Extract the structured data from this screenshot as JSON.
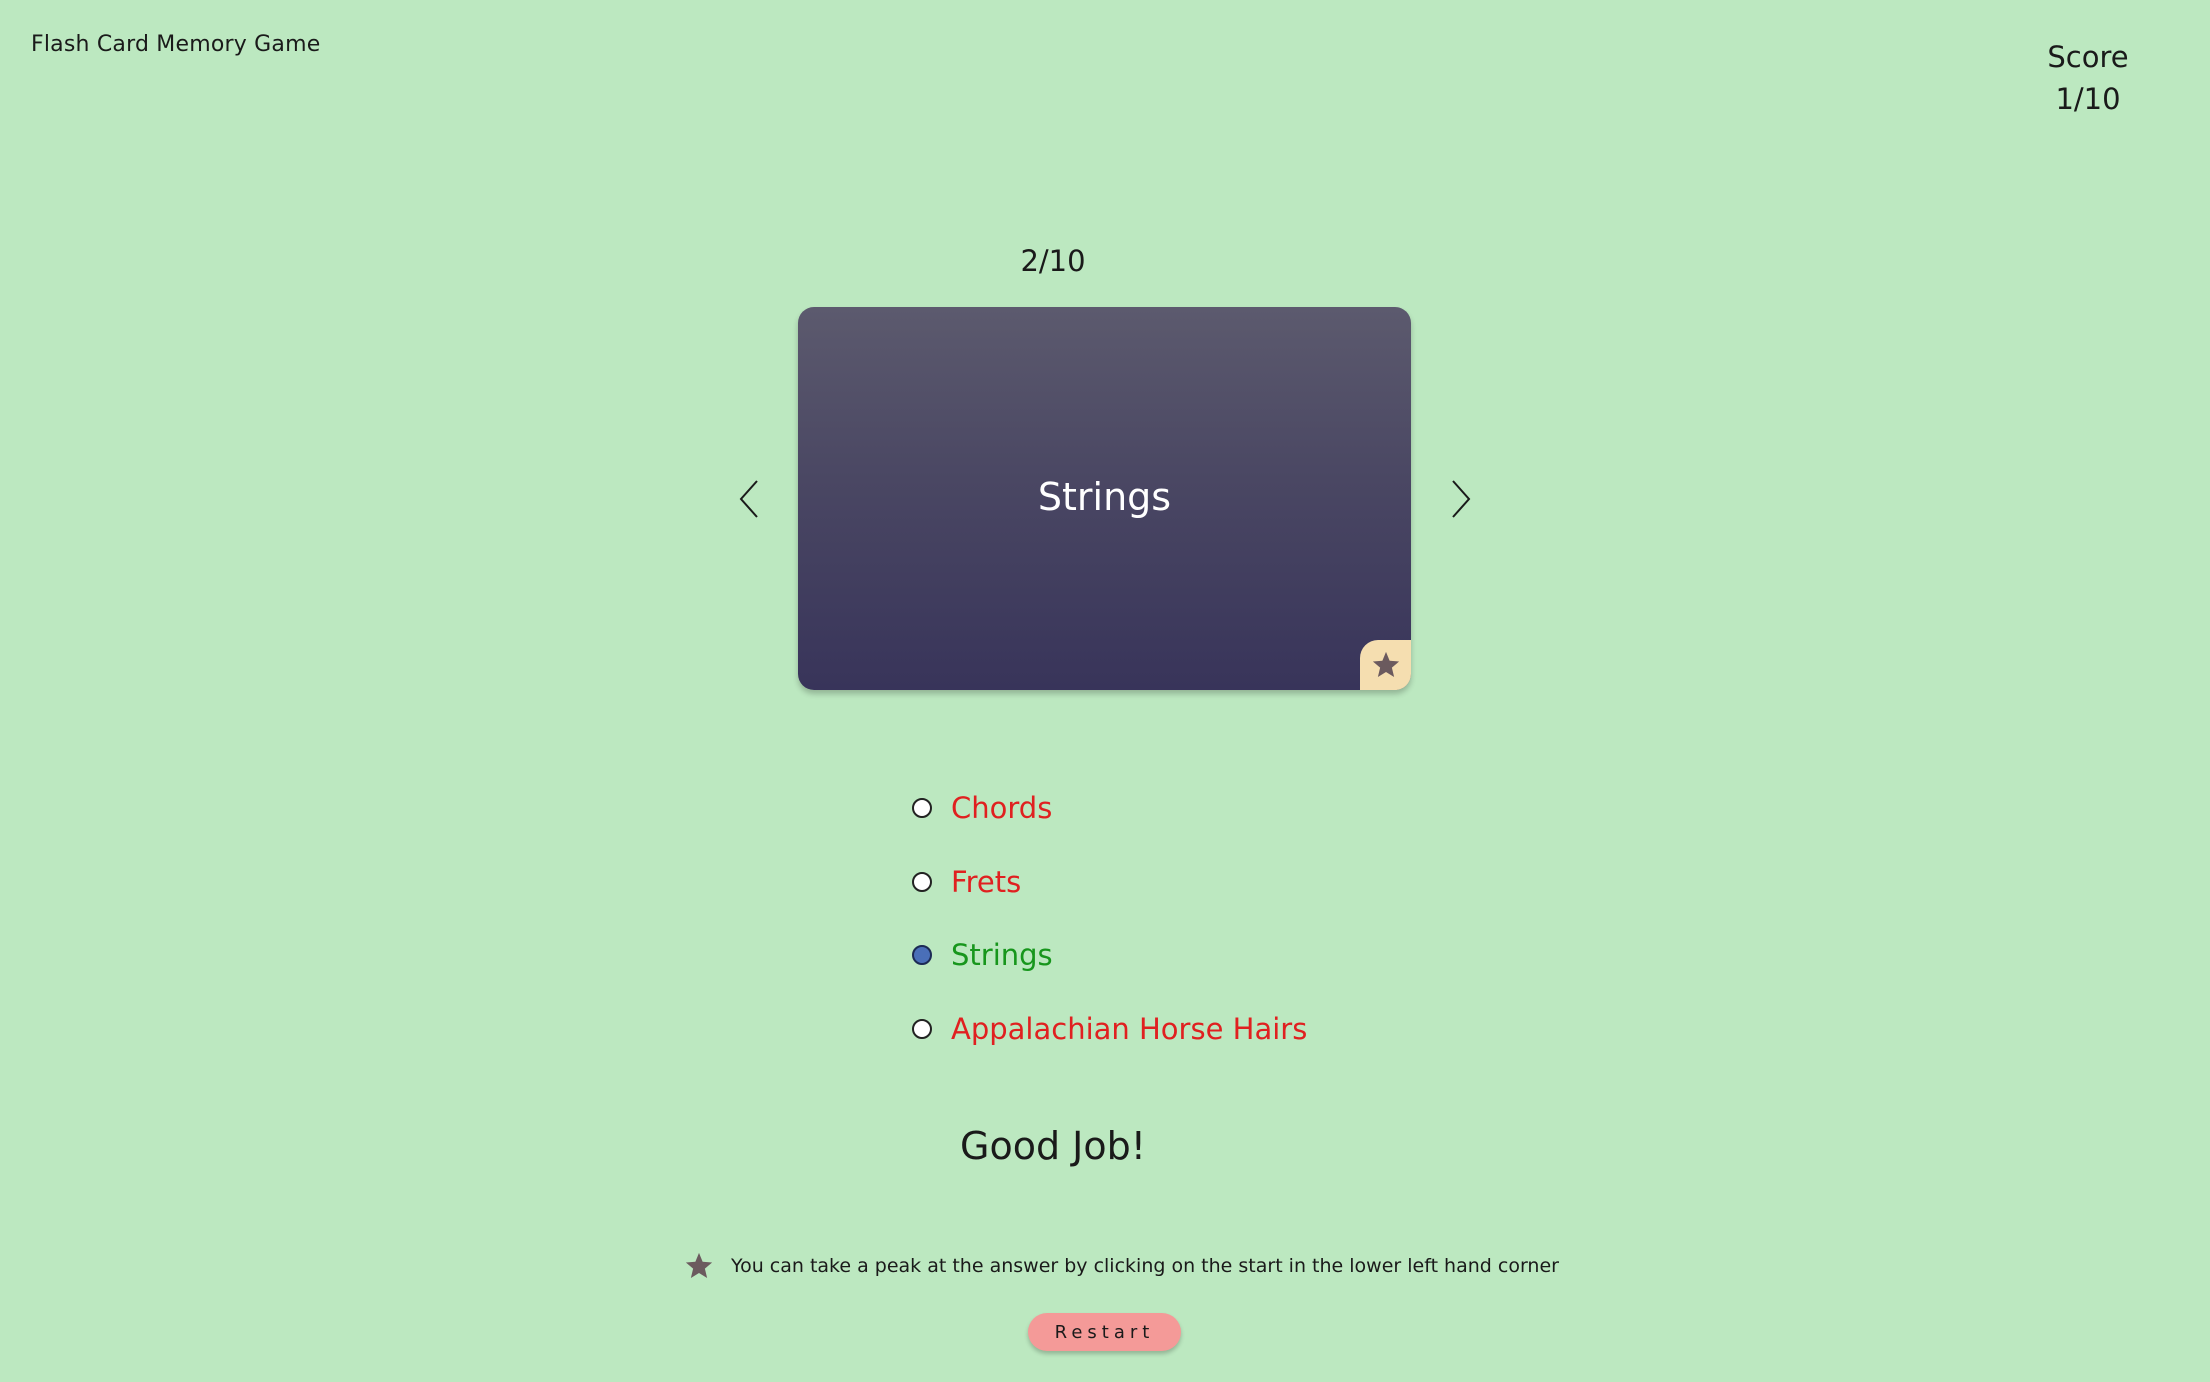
{
  "header": {
    "title": "Flash Card Memory Game"
  },
  "score": {
    "label": "Score",
    "value": "1/10"
  },
  "progress": {
    "text": "2/10"
  },
  "card": {
    "text": "Strings",
    "peek_icon": "star-icon"
  },
  "navigation": {
    "prev_icon": "chevron-left-icon",
    "next_icon": "chevron-right-icon"
  },
  "options": [
    {
      "label": "Chords",
      "selected": false,
      "status": "wrong"
    },
    {
      "label": "Frets",
      "selected": false,
      "status": "wrong"
    },
    {
      "label": "Strings",
      "selected": true,
      "status": "correct"
    },
    {
      "label": "Appalachian Horse Hairs",
      "selected": false,
      "status": "wrong"
    }
  ],
  "feedback": {
    "text": "Good Job!"
  },
  "hint": {
    "icon": "star-icon",
    "text": "You can take a peak at the answer by clicking on the start in the lower left hand corner"
  },
  "restart": {
    "label": "Restart"
  },
  "colors": {
    "background": "#bce8c0",
    "card": "#4a4763",
    "peek_badge": "#f5deb0",
    "correct": "#17961c",
    "wrong": "#e02020",
    "selected_radio": "#4a6fb8",
    "restart_button": "#f49a98"
  }
}
